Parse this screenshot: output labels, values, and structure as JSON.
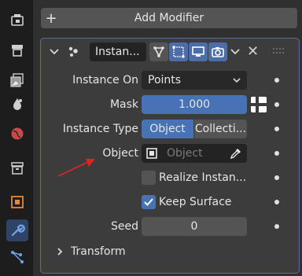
{
  "toolbar": {
    "icons": [
      "tool-icon",
      "render-icon",
      "output-icon",
      "view-layer-icon",
      "scene-icon",
      "world-icon",
      "collection-icon",
      "object-icon",
      "modifier-icon",
      "particles-icon"
    ]
  },
  "add_modifier": {
    "label": "Add Modifier"
  },
  "modifier": {
    "name": "Instan...",
    "rows": {
      "instance_on": {
        "label": "Instance On",
        "value": "Points"
      },
      "mask": {
        "label": "Mask",
        "value": "1.000"
      },
      "instance_type": {
        "label": "Instance Type",
        "option_a": "Object",
        "option_b": "Collecti..."
      },
      "object": {
        "label": "Object",
        "placeholder": "Object"
      },
      "realize": {
        "label": "Realize Instan...",
        "checked": false
      },
      "keep_surface": {
        "label": "Keep Surface",
        "checked": true
      },
      "seed": {
        "label": "Seed",
        "value": "0"
      }
    },
    "subpanel": {
      "label": "Transform"
    }
  },
  "colors": {
    "accent": "#4772b3",
    "panel_border": "#5c6f93",
    "annotation_arrow": "#e02424"
  }
}
